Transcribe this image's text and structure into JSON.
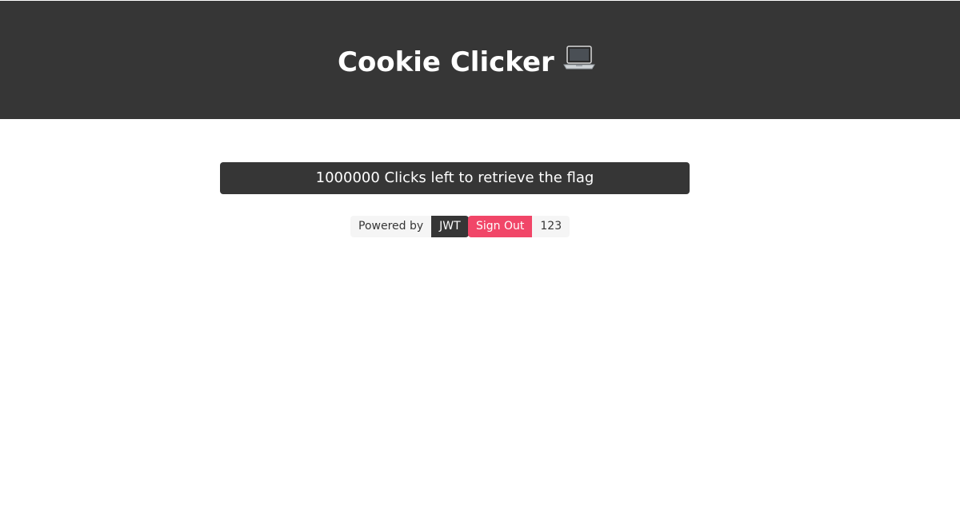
{
  "header": {
    "title": "Cookie Clicker",
    "icon": "laptop-icon"
  },
  "main": {
    "click_button_label": "1000000 Clicks left to retrieve the flag"
  },
  "tags": {
    "powered_label": "Powered by",
    "powered_value": "JWT",
    "sign_out_label": "Sign Out",
    "username": "123"
  },
  "colors": {
    "hero_bg": "#363636",
    "danger": "#f14668",
    "light_tag": "#f5f5f5"
  }
}
